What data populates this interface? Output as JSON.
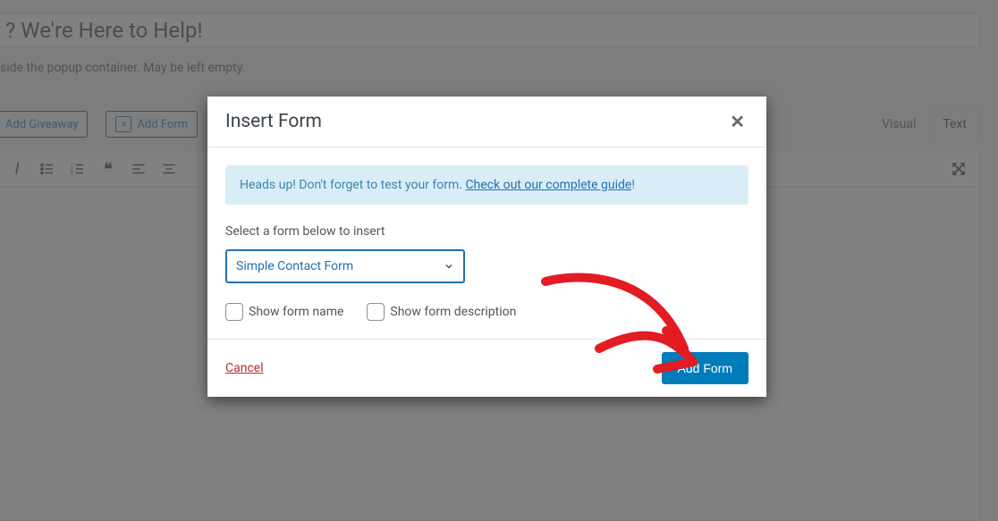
{
  "background": {
    "title_input": "? We're Here to Help!",
    "subtitle": "side the popup container. May be left empty.",
    "buttons": {
      "add_giveaway": "Add Giveaway",
      "add_form": "Add Form"
    },
    "tabs": {
      "visual": "Visual",
      "text": "Text"
    }
  },
  "modal": {
    "title": "Insert Form",
    "alert": {
      "prefix": "Heads up! Don't forget to test your form. ",
      "link_text": "Check out our complete guide",
      "suffix": "!"
    },
    "select_label": "Select a form below to insert",
    "select_value": "Simple Contact Form",
    "checkbox_name": "Show form name",
    "checkbox_desc": "Show form description",
    "cancel": "Cancel",
    "add_form": "Add Form"
  }
}
